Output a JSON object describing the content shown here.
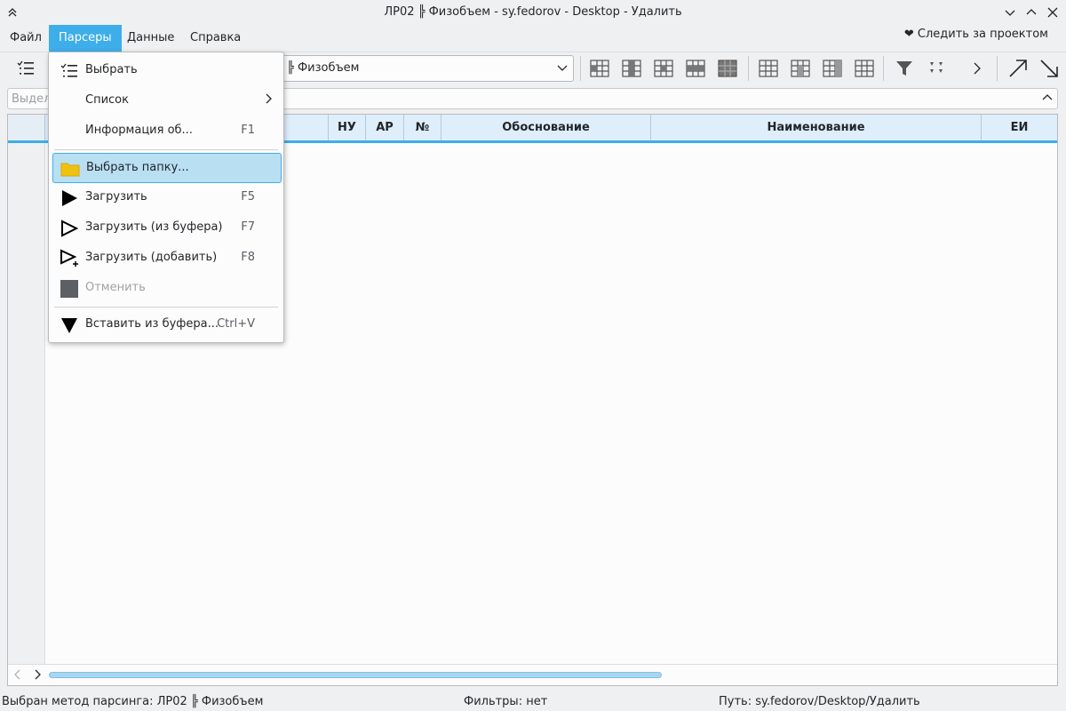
{
  "window": {
    "title": "ЛР02 ╠ Физобъем - sy.fedorov - Desktop - Удалить"
  },
  "menubar": {
    "items": [
      "Файл",
      "Парсеры",
      "Данные",
      "Справка"
    ],
    "follow_label": "❤ Следить за проектом"
  },
  "toolbar": {
    "combo_value": "╠ Физобъем"
  },
  "filter": {
    "placeholder": "Выдел"
  },
  "table": {
    "columns": [
      "НУ",
      "АР",
      "№",
      "Обоснование",
      "Наименование",
      "ЕИ"
    ]
  },
  "dropdown": {
    "items": [
      {
        "label": "Выбрать",
        "shortcut": "",
        "icon": "list-select-icon"
      },
      {
        "label": "Список",
        "shortcut": "",
        "icon": "",
        "submenu": true
      },
      {
        "label": "Информация об...",
        "shortcut": "F1",
        "icon": ""
      },
      {
        "label": "Выбрать папку...",
        "shortcut": "",
        "icon": "folder-icon"
      },
      {
        "label": "Загрузить",
        "shortcut": "F5",
        "icon": "play-filled-icon"
      },
      {
        "label": "Загрузить (из буфера)",
        "shortcut": "F7",
        "icon": "play-outline-icon"
      },
      {
        "label": "Загрузить (добавить)",
        "shortcut": "F8",
        "icon": "play-add-icon"
      },
      {
        "label": "Отменить",
        "shortcut": "",
        "icon": "stop-icon",
        "disabled": true
      },
      {
        "label": "Вставить из буфера...",
        "shortcut": "Ctrl+V",
        "icon": "down-triangle-icon"
      }
    ]
  },
  "status": {
    "method": "Выбран метод парсинга: ЛР02 ╠ Физобъем",
    "filters": "Фильтры: нет",
    "path": "Путь: sy.fedorov/Desktop/Удалить"
  },
  "colors": {
    "accent": "#3daee9",
    "highlight": "#b9dff3",
    "folder": "#f0c20f"
  }
}
